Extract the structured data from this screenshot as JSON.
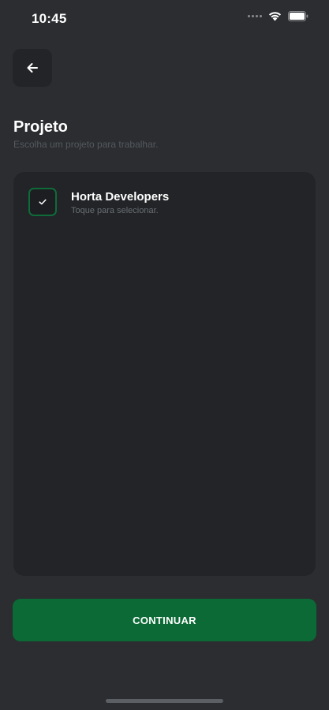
{
  "status_bar": {
    "time": "10:45",
    "icons": [
      "signal-dots-icon",
      "wifi-icon",
      "battery-icon"
    ]
  },
  "header": {
    "back_icon": "arrow-left-icon",
    "title": "Projeto",
    "subtitle": "Escolha um projeto para trabalhar."
  },
  "projects": [
    {
      "name": "Horta Developers",
      "hint": "Toque para selecionar.",
      "selected": true
    }
  ],
  "actions": {
    "continue_label": "CONTINUAR"
  },
  "colors": {
    "background": "#2b2d30",
    "card": "#222427",
    "accent_green": "#0b6a35",
    "checkbox_border": "#0f6b3a"
  }
}
